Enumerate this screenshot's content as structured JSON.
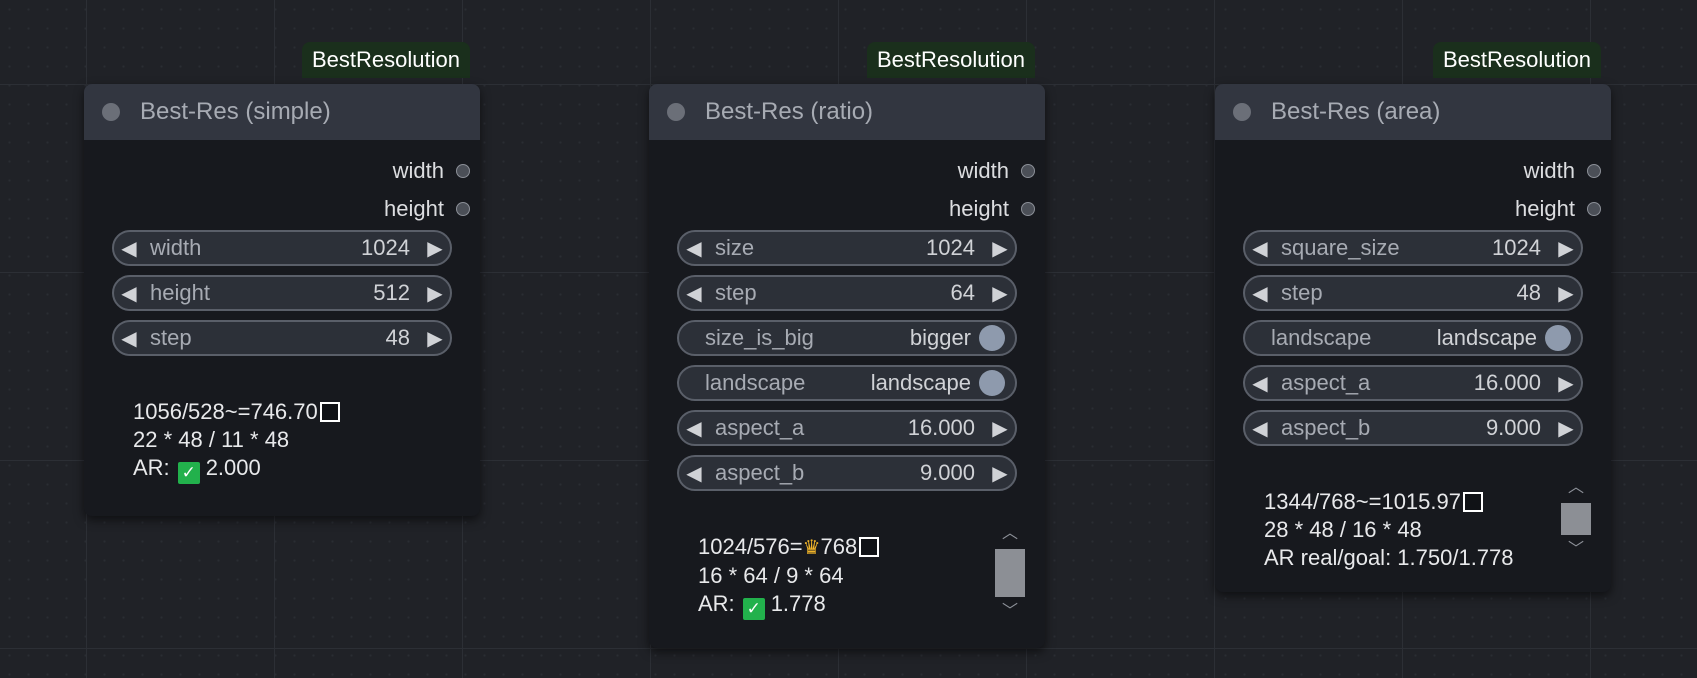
{
  "nodes": [
    {
      "badge": "BestResolution",
      "title": "Best-Res (simple)",
      "outputs": [
        "width",
        "height"
      ],
      "widgets": [
        {
          "label": "width",
          "value": "1024"
        },
        {
          "label": "height",
          "value": "512"
        },
        {
          "label": "step",
          "value": "48"
        }
      ],
      "info": {
        "line1": "1056/528~=746.70",
        "line2": "22 * 48 / 11 * 48",
        "ar_label": "AR:",
        "ar_value": "2.000"
      }
    },
    {
      "badge": "BestResolution",
      "title": "Best-Res (ratio)",
      "outputs": [
        "width",
        "height"
      ],
      "widgets": [
        {
          "label": "size",
          "value": "1024"
        },
        {
          "label": "step",
          "value": "64"
        },
        {
          "label": "size_is_big",
          "value": "bigger"
        },
        {
          "label": "landscape",
          "value": "landscape"
        },
        {
          "label": "aspect_a",
          "value": "16.000"
        },
        {
          "label": "aspect_b",
          "value": "9.000"
        }
      ],
      "info": {
        "line1_pre": "1024/576=",
        "line1_post": "768",
        "line2": "16 * 64 / 9 * 64",
        "ar_label": "AR:",
        "ar_value": "1.778"
      }
    },
    {
      "badge": "BestResolution",
      "title": "Best-Res (area)",
      "outputs": [
        "width",
        "height"
      ],
      "widgets": [
        {
          "label": "square_size",
          "value": "1024"
        },
        {
          "label": "step",
          "value": "48"
        },
        {
          "label": "landscape",
          "value": "landscape"
        },
        {
          "label": "aspect_a",
          "value": "16.000"
        },
        {
          "label": "aspect_b",
          "value": "9.000"
        }
      ],
      "info": {
        "line1": "1344/768~=1015.97",
        "line2": "28 * 48 / 16 * 48",
        "line3": "AR real/goal: 1.750/1.778"
      }
    }
  ],
  "icons": {
    "arrow_left": "◀",
    "arrow_right": "▶",
    "check": "✓",
    "crown": "♛",
    "scroll_up": "︿",
    "scroll_down": "﹀"
  },
  "colors": {
    "canvas_bg": "#202227",
    "node_bg": "#17191e",
    "node_header": "#323640",
    "badge_bg": "#1a2f1c",
    "widget_bg": "#2c3038",
    "toggle_knob": "#8e9aad",
    "check_green": "#22b14c"
  }
}
